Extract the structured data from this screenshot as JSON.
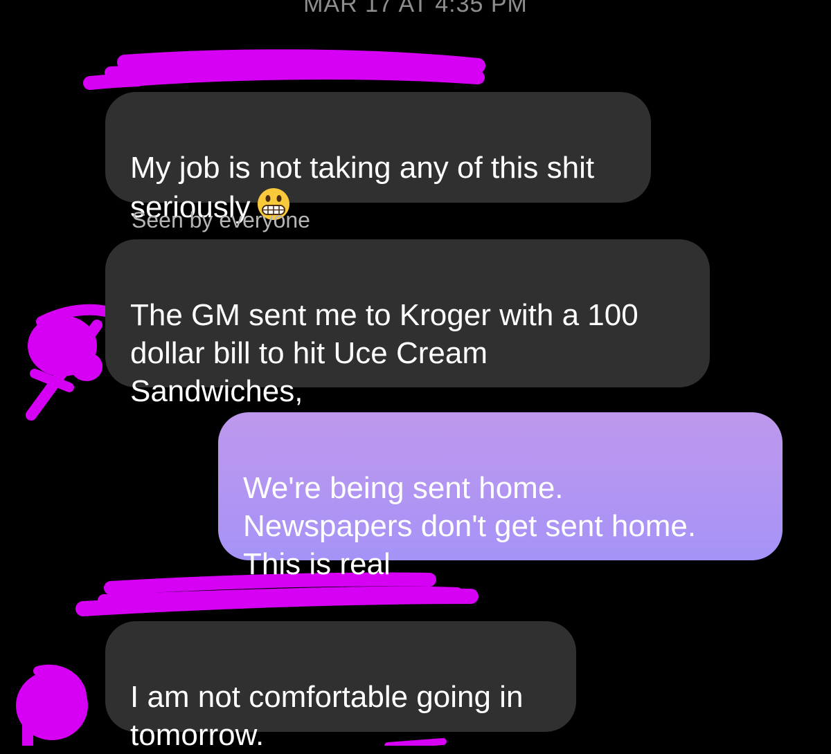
{
  "thread": {
    "timestamp": "MAR 17 AT 4:35 PM",
    "messages": [
      {
        "direction": "incoming",
        "text": "My job is not taking any of this shit\nseriously",
        "emoji": "grimacing-face"
      },
      {
        "direction": "incoming",
        "text": "The GM sent me to Kroger with a 100\ndollar bill to hit Uce Cream\nSandwiches,"
      },
      {
        "direction": "outgoing",
        "text": "We're being sent home.\nNewspapers don't get sent home.\nThis is real"
      },
      {
        "direction": "incoming",
        "text": "I am not comfortable going in\ntomorrow."
      }
    ],
    "seen_status": "Seen by everyone"
  },
  "colors": {
    "background": "#000000",
    "incoming_bubble": "#303030",
    "outgoing_gradient_top": "#be98ec",
    "outgoing_gradient_bottom": "#a693f7",
    "redaction": "#d600f5"
  }
}
